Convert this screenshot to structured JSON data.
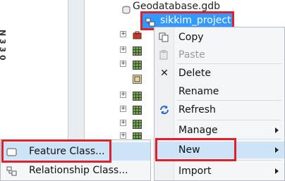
{
  "tree": {
    "geodatabase_label": "Geodatabase.gdb",
    "selected_item_label": "sikkim_project"
  },
  "context_menu": {
    "items": [
      {
        "label": "Copy",
        "icon": "copy-icon",
        "enabled": true
      },
      {
        "label": "Paste",
        "icon": "paste-icon",
        "enabled": false
      },
      {
        "label": "Delete",
        "icon": "delete-icon",
        "enabled": true
      },
      {
        "label": "Rename",
        "icon": "",
        "enabled": true
      },
      {
        "label": "Refresh",
        "icon": "refresh-icon",
        "enabled": true
      },
      {
        "label": "Manage",
        "icon": "",
        "enabled": true,
        "submenu": true
      },
      {
        "label": "New",
        "icon": "",
        "enabled": true,
        "submenu": true,
        "highlighted": true
      },
      {
        "label": "Import",
        "icon": "",
        "enabled": true,
        "submenu": true
      }
    ]
  },
  "submenu": {
    "items": [
      {
        "label": "Feature Class...",
        "icon": "feature-class-icon",
        "highlighted": true
      },
      {
        "label": "Relationship Class...",
        "icon": "relationship-class-icon"
      }
    ]
  },
  "left_pane": {
    "clipped_text": "N 3 3 0"
  },
  "colors": {
    "selection_blue": "#3399ff",
    "hover_blue": "#cde3f8",
    "annotation_red": "#e0212a",
    "menu_background": "#f5f6f7"
  }
}
